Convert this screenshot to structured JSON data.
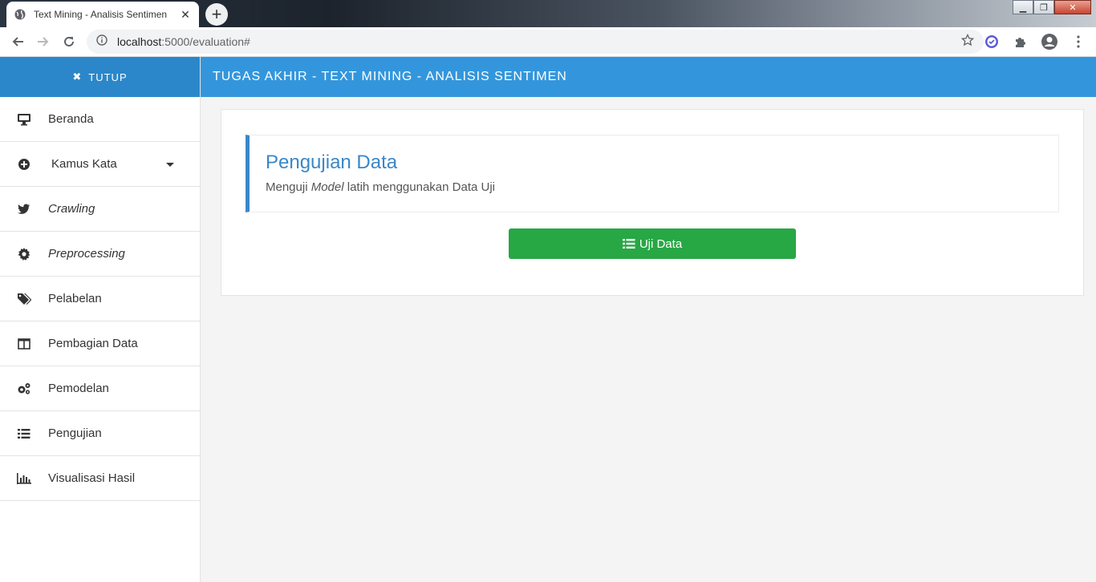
{
  "browser": {
    "tab_title": "Text Mining - Analisis Sentimen",
    "url_host": "localhost",
    "url_path": ":5000/evaluation#"
  },
  "sidebar": {
    "close_label": "TUTUP",
    "items": [
      {
        "label": "Beranda",
        "icon": "desktop-icon"
      },
      {
        "label": "Kamus Kata",
        "icon": "plus-circle-icon"
      },
      {
        "label": "Crawling",
        "icon": "twitter-icon"
      },
      {
        "label": "Preprocessing",
        "icon": "gear-icon"
      },
      {
        "label": "Pelabelan",
        "icon": "tags-icon"
      },
      {
        "label": "Pembagian Data",
        "icon": "columns-icon"
      },
      {
        "label": "Pemodelan",
        "icon": "cogs-icon"
      },
      {
        "label": "Pengujian",
        "icon": "list-icon"
      },
      {
        "label": "Visualisasi Hasil",
        "icon": "bar-chart-icon"
      }
    ]
  },
  "header": {
    "title": "TUGAS AKHIR - TEXT MINING - ANALISIS SENTIMEN"
  },
  "main": {
    "heading": "Pengujian Data",
    "subtitle_pre": "Menguji ",
    "subtitle_em": "Model",
    "subtitle_post": " latih menggunakan Data Uji",
    "button_label": "Uji Data"
  },
  "colors": {
    "header_blue": "#3396dc",
    "sidebar_head_blue": "#2b87c9",
    "accent_blue": "#3a87c8",
    "button_green": "#28a745"
  }
}
